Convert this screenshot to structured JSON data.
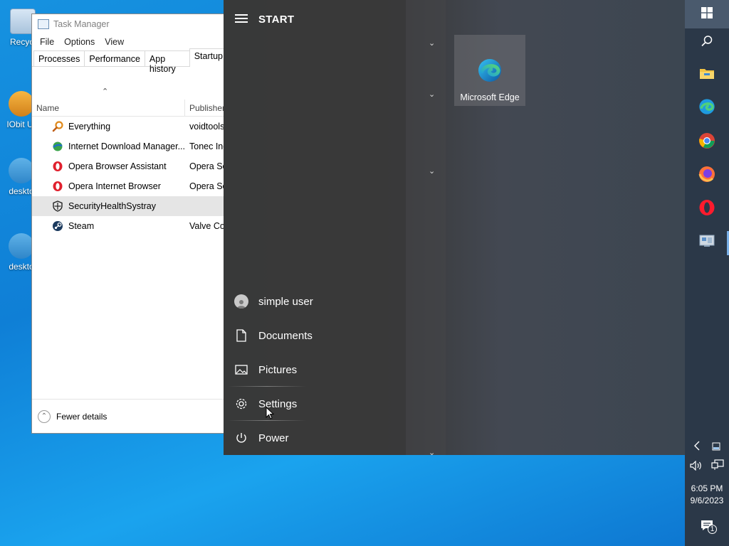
{
  "desktop": {
    "icons": [
      {
        "label": "Recycl"
      },
      {
        "label": "IObit Ur"
      },
      {
        "label": "deskto"
      },
      {
        "label": "deskto"
      }
    ]
  },
  "task_manager": {
    "title": "Task Manager",
    "menu": [
      "File",
      "Options",
      "View"
    ],
    "tabs": [
      "Processes",
      "Performance",
      "App history",
      "Startup"
    ],
    "active_tab": "Startup",
    "columns": {
      "name": "Name",
      "publisher": "Publisher"
    },
    "rows": [
      {
        "name": "Everything",
        "publisher": "voidtools",
        "icon": "magnifier-icon"
      },
      {
        "name": "Internet Download Manager...",
        "publisher": "Tonec Inc.",
        "icon": "idm-globe-icon"
      },
      {
        "name": "Opera Browser Assistant",
        "publisher": "Opera Software",
        "icon": "opera-icon"
      },
      {
        "name": "Opera Internet Browser",
        "publisher": "Opera Software",
        "icon": "opera-icon"
      },
      {
        "name": "SecurityHealthSystray",
        "publisher": "",
        "icon": "shield-icon"
      },
      {
        "name": "Steam",
        "publisher": "Valve Corporation",
        "icon": "steam-icon"
      }
    ],
    "selected_row": "SecurityHealthSystray",
    "footer": "Fewer details"
  },
  "start_menu": {
    "title": "START",
    "tile": {
      "label": "Microsoft Edge"
    },
    "items": {
      "user": "simple user",
      "documents": "Documents",
      "pictures": "Pictures",
      "settings": "Settings",
      "power": "Power"
    }
  },
  "taskbar": {
    "apps": [
      "windows-start-icon",
      "search-icon",
      "file-explorer-icon",
      "edge-icon",
      "chrome-icon",
      "firefox-icon",
      "opera-icon",
      "control-panel-icon"
    ],
    "time": "6:05 PM",
    "date": "9/6/2023",
    "notification_count": "1"
  },
  "colors": {
    "desktop": "#1692e0",
    "start_bg": "#3a3b3c",
    "taskbar": "#2b3848",
    "accent": "#7ab0e8"
  }
}
